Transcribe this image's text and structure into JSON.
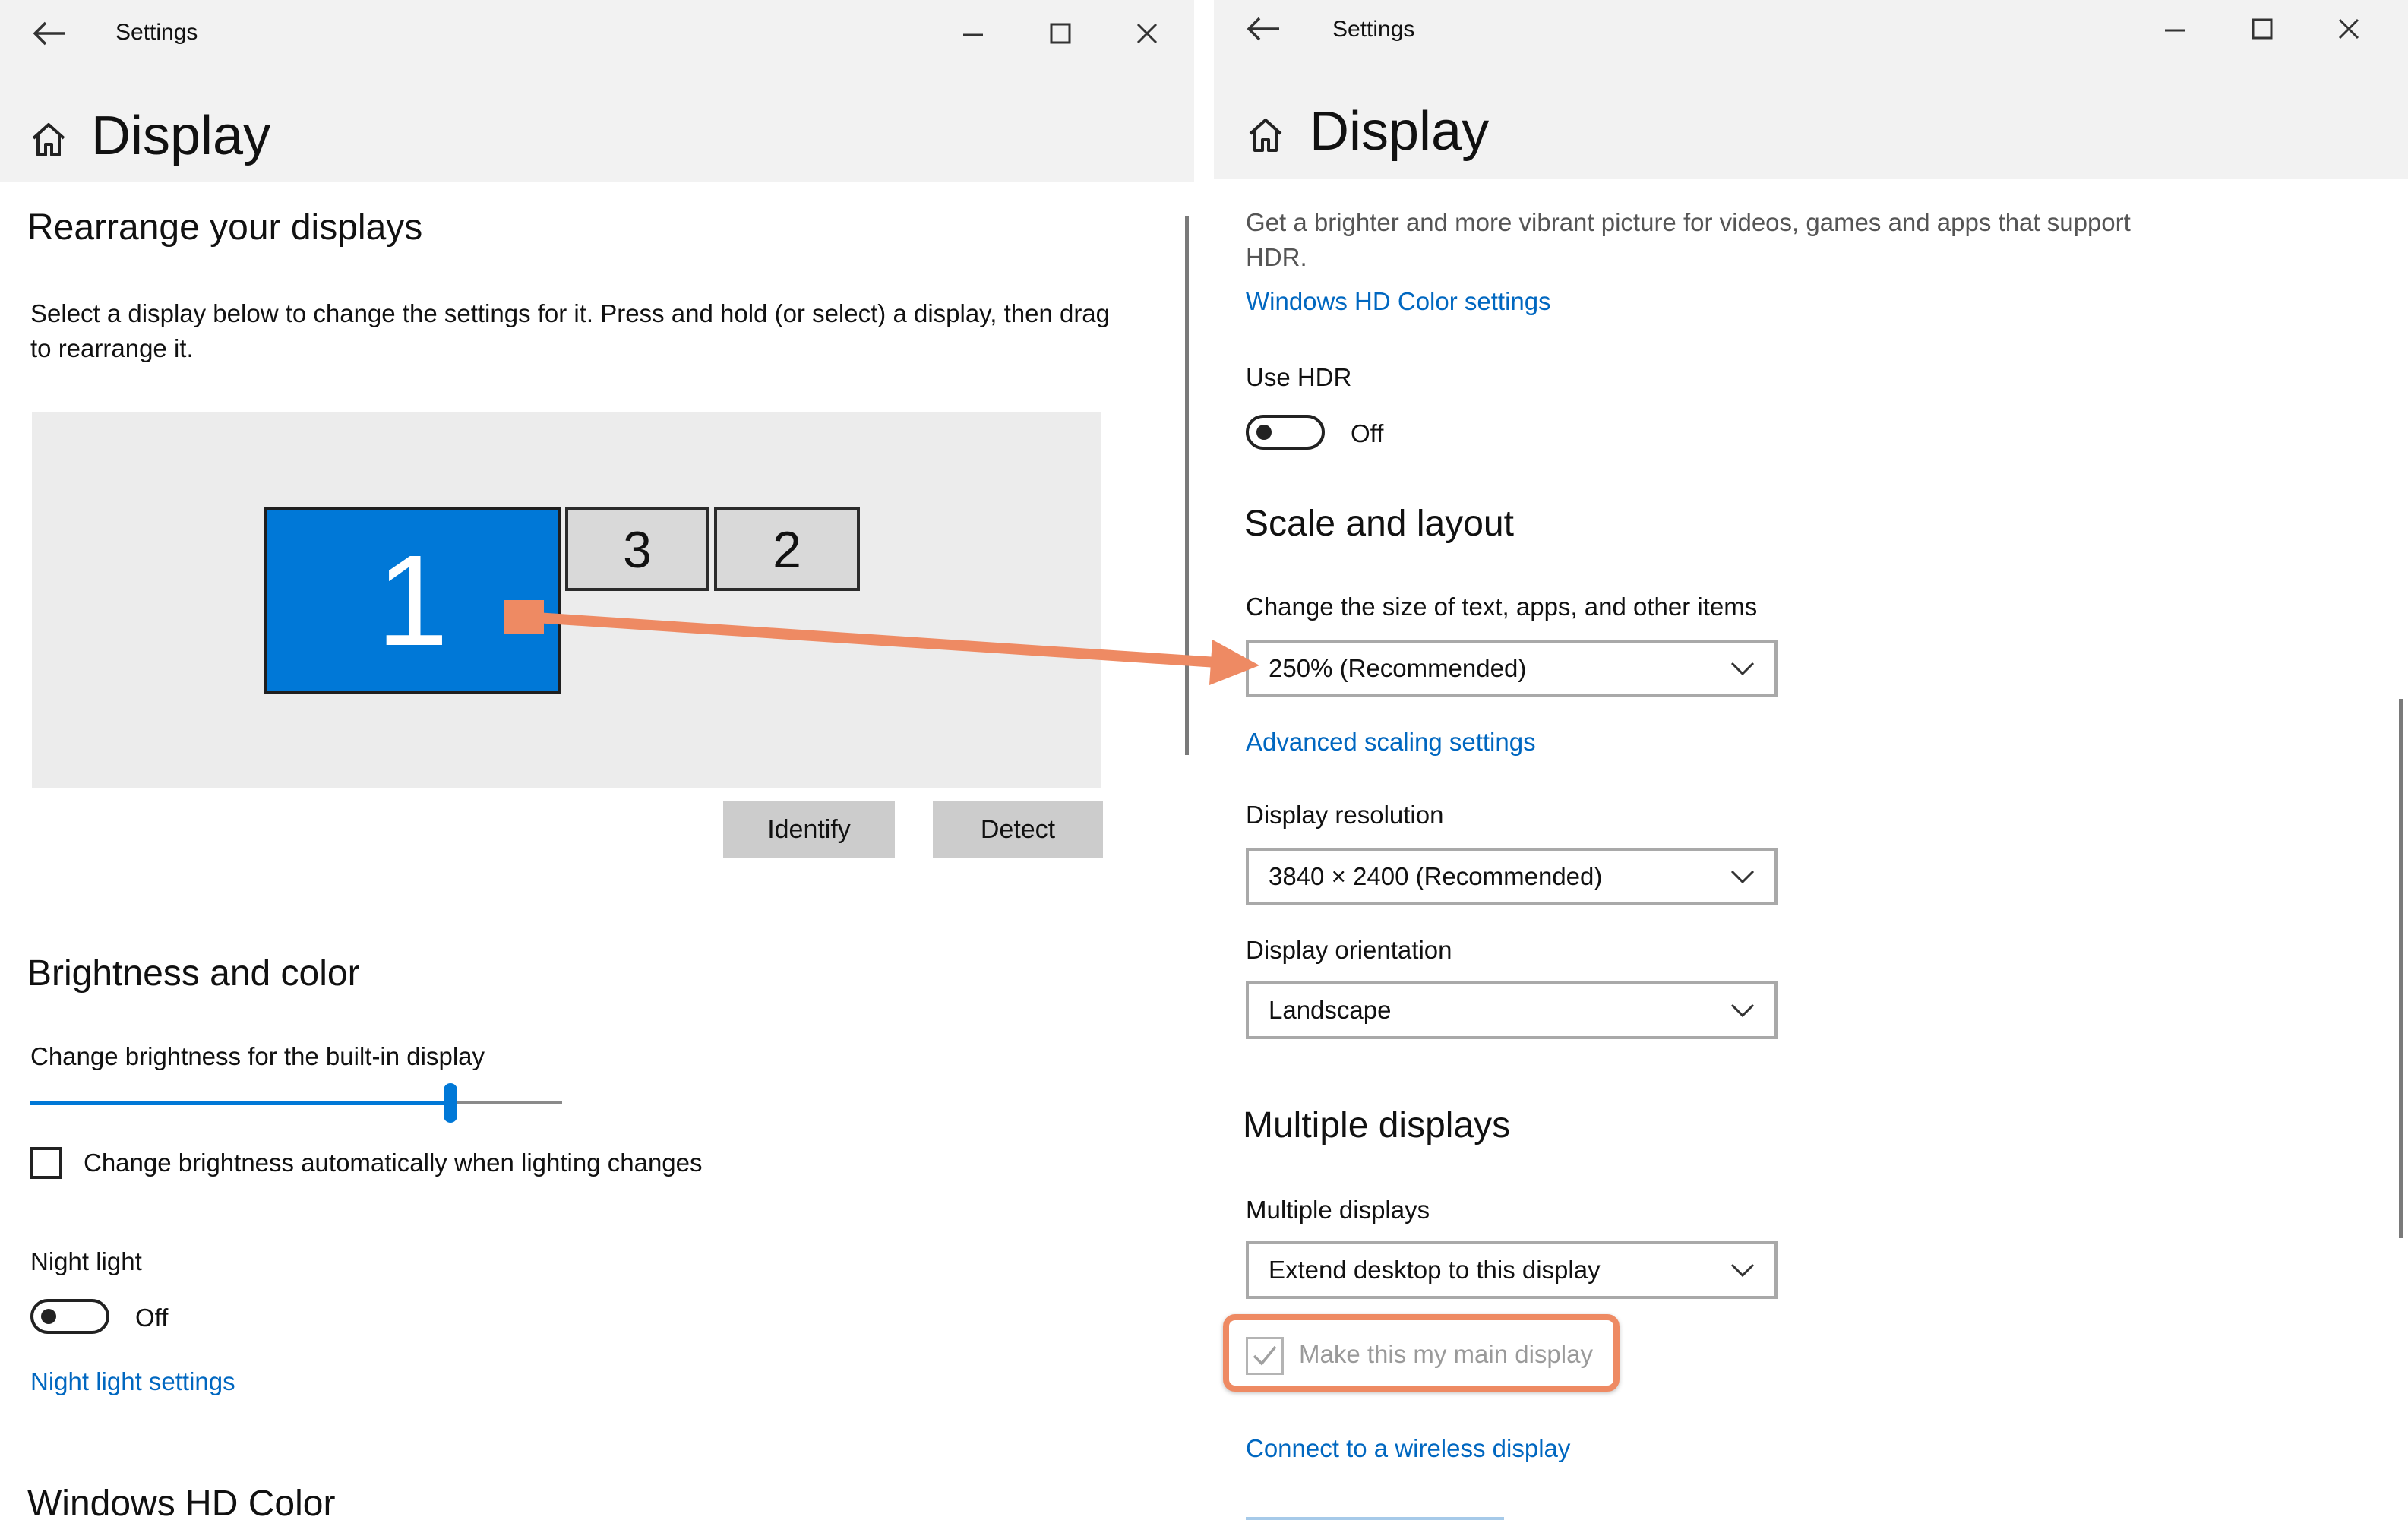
{
  "left_window": {
    "title": "Settings",
    "page_title": "Display",
    "rearrange": {
      "heading": "Rearrange your displays",
      "description": "Select a display below to change the settings for it. Press and hold (or select) a display, then drag to rearrange it.",
      "displays": [
        "1",
        "3",
        "2"
      ],
      "identify_label": "Identify",
      "detect_label": "Detect"
    },
    "brightness": {
      "heading": "Brightness and color",
      "slider_label": "Change brightness for the built-in display",
      "slider_value_percent": 79,
      "auto_checkbox_label": "Change brightness automatically when lighting changes"
    },
    "night_light": {
      "label": "Night light",
      "state": "Off",
      "settings_link": "Night light settings"
    },
    "next_section": "Windows HD Color"
  },
  "right_window": {
    "title": "Settings",
    "page_title": "Display",
    "hdr": {
      "description": "Get a brighter and more vibrant picture for videos, games and apps that support HDR.",
      "settings_link": "Windows HD Color settings",
      "use_hdr_label": "Use HDR",
      "state": "Off"
    },
    "scale_layout": {
      "heading": "Scale and layout",
      "size_label": "Change the size of text, apps, and other items",
      "size_value": "250% (Recommended)",
      "advanced_link": "Advanced scaling settings",
      "resolution_label": "Display resolution",
      "resolution_value": "3840 × 2400 (Recommended)",
      "orientation_label": "Display orientation",
      "orientation_value": "Landscape"
    },
    "multiple": {
      "heading": "Multiple displays",
      "label": "Multiple displays",
      "value": "Extend desktop to this display",
      "main_display_label": "Make this my main display",
      "wireless_link": "Connect to a wireless display"
    }
  },
  "colors": {
    "accent": "#0067c0",
    "selected_display": "#0078d7",
    "annotation": "#ee8a63"
  }
}
